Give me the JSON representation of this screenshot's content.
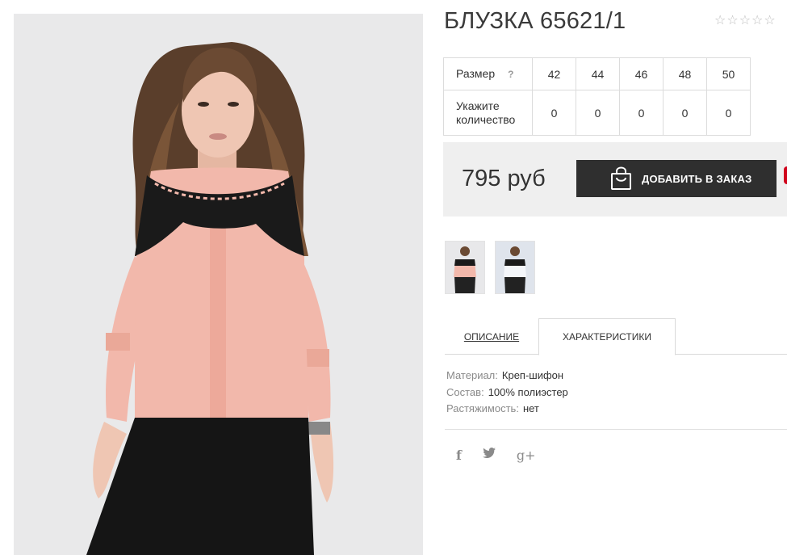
{
  "product": {
    "title": "БЛУЗКА 65621/1",
    "rating_stars": [
      "☆",
      "☆",
      "☆",
      "☆",
      "☆"
    ],
    "rating_value": 0,
    "rating_max": 5
  },
  "sizes": {
    "label": "Размер",
    "help": "?",
    "values": [
      "42",
      "44",
      "46",
      "48",
      "50"
    ],
    "qty_label": "Укажите количество",
    "quantities": [
      "0",
      "0",
      "0",
      "0",
      "0"
    ]
  },
  "buy": {
    "price": "795 руб",
    "button_label": "ДОБАВИТЬ В ЗАКАЗ",
    "button_icon": "shopping-bag-icon"
  },
  "tabs": [
    {
      "label": "ОПИСАНИЕ",
      "active": false
    },
    {
      "label": "ХАРАКТЕРИСТИКИ",
      "active": true
    }
  ],
  "specs": [
    {
      "key": "Материал:",
      "value": "Креп-шифон"
    },
    {
      "key": "Состав:",
      "value": "100% полиэстер"
    },
    {
      "key": "Растяжимость:",
      "value": "нет"
    }
  ],
  "social": {
    "facebook": "f",
    "twitter": "🐦",
    "google_plus": "g+"
  },
  "colors": {
    "blouse_pink": "#f2b8ab",
    "lace_black": "#1a1a1a",
    "button_bg": "#2f2f2f",
    "buybox_bg": "#efefef",
    "photo_bg": "#e9e9ea",
    "accent_red": "#d0021b"
  }
}
